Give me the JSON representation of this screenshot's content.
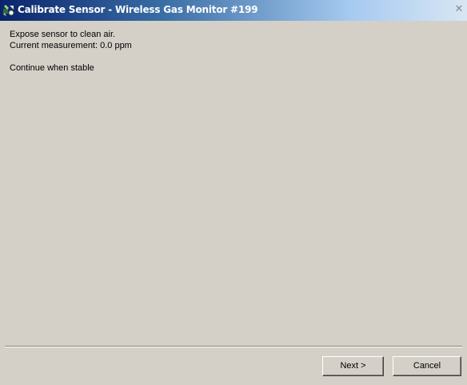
{
  "window": {
    "title": "Calibrate Sensor - Wireless Gas Monitor #199",
    "title_icon": "sensor-app-icon",
    "close_glyph": "✕"
  },
  "content": {
    "line1": "Expose sensor to clean air.",
    "line2": "Current measurement: 0.0 ppm",
    "line3": "Continue when stable"
  },
  "buttons": {
    "next_label": "Next >",
    "cancel_label": "Cancel"
  },
  "colors": {
    "dialog_bg": "#d4d0c8",
    "titlebar_start": "#0a246a",
    "titlebar_end": "#d8e6f4"
  }
}
